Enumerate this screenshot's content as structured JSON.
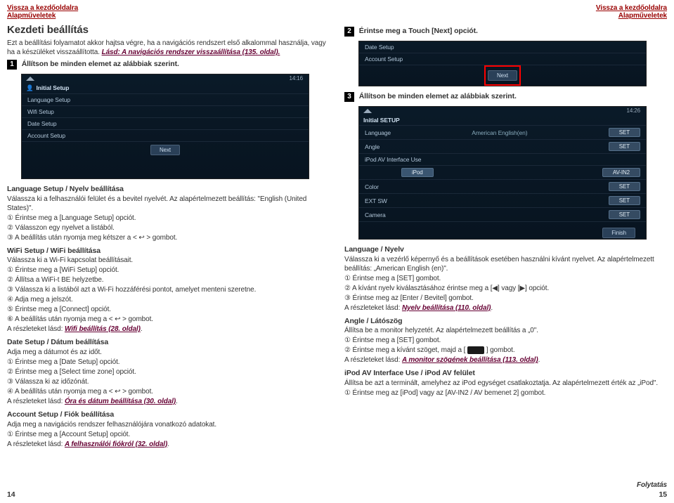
{
  "header": {
    "backToHome": "Vissza a kezdőoldalra",
    "basics": "Alapműveletek"
  },
  "left": {
    "title": "Kezdeti beállítás",
    "intro1": "Ezt a beállítási folyamatot akkor hajtsa végre, ha a navigációs rendszert első alkalommal használja, vagy ha a készüléket visszaállította. ",
    "introLink": "Lásd: A navigációs rendszer visszaállítása (135. oldal).",
    "step1": "Állítson be minden elemet az alábbiak szerint.",
    "ss1": {
      "time": "14:16",
      "title": "Initial Setup",
      "rows": [
        "Language Setup",
        "Wifi Setup",
        "Date Setup",
        "Account Setup"
      ],
      "next": "Next"
    },
    "lang": {
      "h": "Language Setup / Nyelv beállítása",
      "p1": "Válassza ki a felhasználói felület és a bevitel nyelvét. Az alapértelmezett beállítás: \"English (United States)\".",
      "li1": "① Érintse meg a [Language Setup] opciót.",
      "li2": "② Válasszon egy nyelvet a listából.",
      "li3": "③ A beállítás után nyomja meg kétszer a < ↩ > gombot."
    },
    "wifi": {
      "h": "WiFi Setup / WiFi beállítása",
      "p1": "Válassza ki a Wi-Fi kapcsolat beállításait.",
      "li1": "① Érintse meg a [WiFi Setup] opciót.",
      "li2": "② Állítsa a WiFi-t BE helyzetbe.",
      "li3": "③ Válassza ki a listából azt a Wi-Fi hozzáférési pontot, amelyet menteni szeretne.",
      "li4": "④ Adja meg a jelszót.",
      "li5": "⑤ Érintse meg a [Connect] opciót.",
      "li6": "⑥ A beállítás után nyomja meg a < ↩ > gombot.",
      "seePrefix": "A részleteket lásd: ",
      "seeLink": "Wifi beállítás (28. oldal)"
    },
    "date": {
      "h": "Date Setup / Dátum beállítása",
      "p1": "Adja meg a dátumot és az időt.",
      "li1": "① Érintse meg a [Date Setup] opciót.",
      "li2": "② Érintse meg a [Select time zone] opciót.",
      "li3": "③ Válassza ki az időzónát.",
      "li4": "④ A beállítás után nyomja meg a < ↩ > gombot.",
      "seePrefix": "A részleteket lásd: ",
      "seeLink": "Óra és dátum beállítása (30. oldal)"
    },
    "acct": {
      "h": "Account Setup / Fiók beállítása",
      "p1": "Adja meg a navigációs rendszer felhasználójára vonatkozó adatokat.",
      "li1": "① Érintse meg a [Account Setup] opciót.",
      "seePrefix": "A részleteket lásd: ",
      "seeLink": "A felhasználói fiókról (32. oldal)"
    },
    "pagenum": "14"
  },
  "right": {
    "step2": "Érintse meg a ",
    "step2bold": "Touch [Next]",
    "step2suffix": " opciót.",
    "ss2": {
      "rows": [
        "Date Setup",
        "Account Setup"
      ],
      "next": "Next"
    },
    "step3": "Állítson be minden elemet az alábbiak szerint.",
    "ss3": {
      "time": "14:26",
      "title": "Initial SETUP",
      "rows": [
        {
          "label": "Language",
          "value": "American English(en)",
          "btn": "SET"
        },
        {
          "label": "Angle",
          "value": "",
          "btn": "SET"
        },
        {
          "label": "iPod AV Interface Use",
          "value": "",
          "btn": ""
        }
      ],
      "ipodRowLeft": "iPod",
      "ipodRowRight": "AV-IN2",
      "color": {
        "label": "Color",
        "btn": "SET"
      },
      "ext": {
        "label": "EXT SW",
        "btn": "SET"
      },
      "camera": {
        "label": "Camera",
        "btn": "SET"
      },
      "finish": "Finish"
    },
    "langSec": {
      "h": "Language / Nyelv",
      "p1": "Válassza ki a vezérlő képernyő és a beállítások esetében használni kívánt nyelvet. Az alapértelmezett beállítás: „American English (en)\".",
      "li1": "① Érintse meg a [SET] gombot.",
      "li2a": "② A kívánt nyelv kiválasztásához érintse meg a [◀] vagy [▶] opciót.",
      "li3": "③ Érintse meg az [Enter / Bevitel] gombot.",
      "seePrefix": "A részleteket lásd: ",
      "seeLink": "Nyelv beállítása (110. oldal)"
    },
    "angleSec": {
      "h": "Angle / Látószög",
      "p1": "Állítsa be a monitor helyzetét. Az alapértelmezett beállítás a „0\".",
      "li1": "① Érintse meg a [SET] gombot.",
      "li2a": "② Érintse meg a kívánt szöget, majd a [ ",
      "li2b": " ] gombot.",
      "seePrefix": "A részleteket lásd: ",
      "seeLink": "A monitor szögének beállítása (113. oldal)"
    },
    "ipodSec": {
      "h": "iPod AV Interface Use / iPod AV felület",
      "p1": "Állítsa be azt a terminált, amelyhez az iPod egységet csatlakoztatja. Az alapértelmezett érték az „iPod\".",
      "li1": "① Érintse meg az [iPod] vagy az [AV-IN2 / AV bemenet 2] gombot."
    },
    "cont": "Folytatás",
    "pagenum": "15"
  }
}
